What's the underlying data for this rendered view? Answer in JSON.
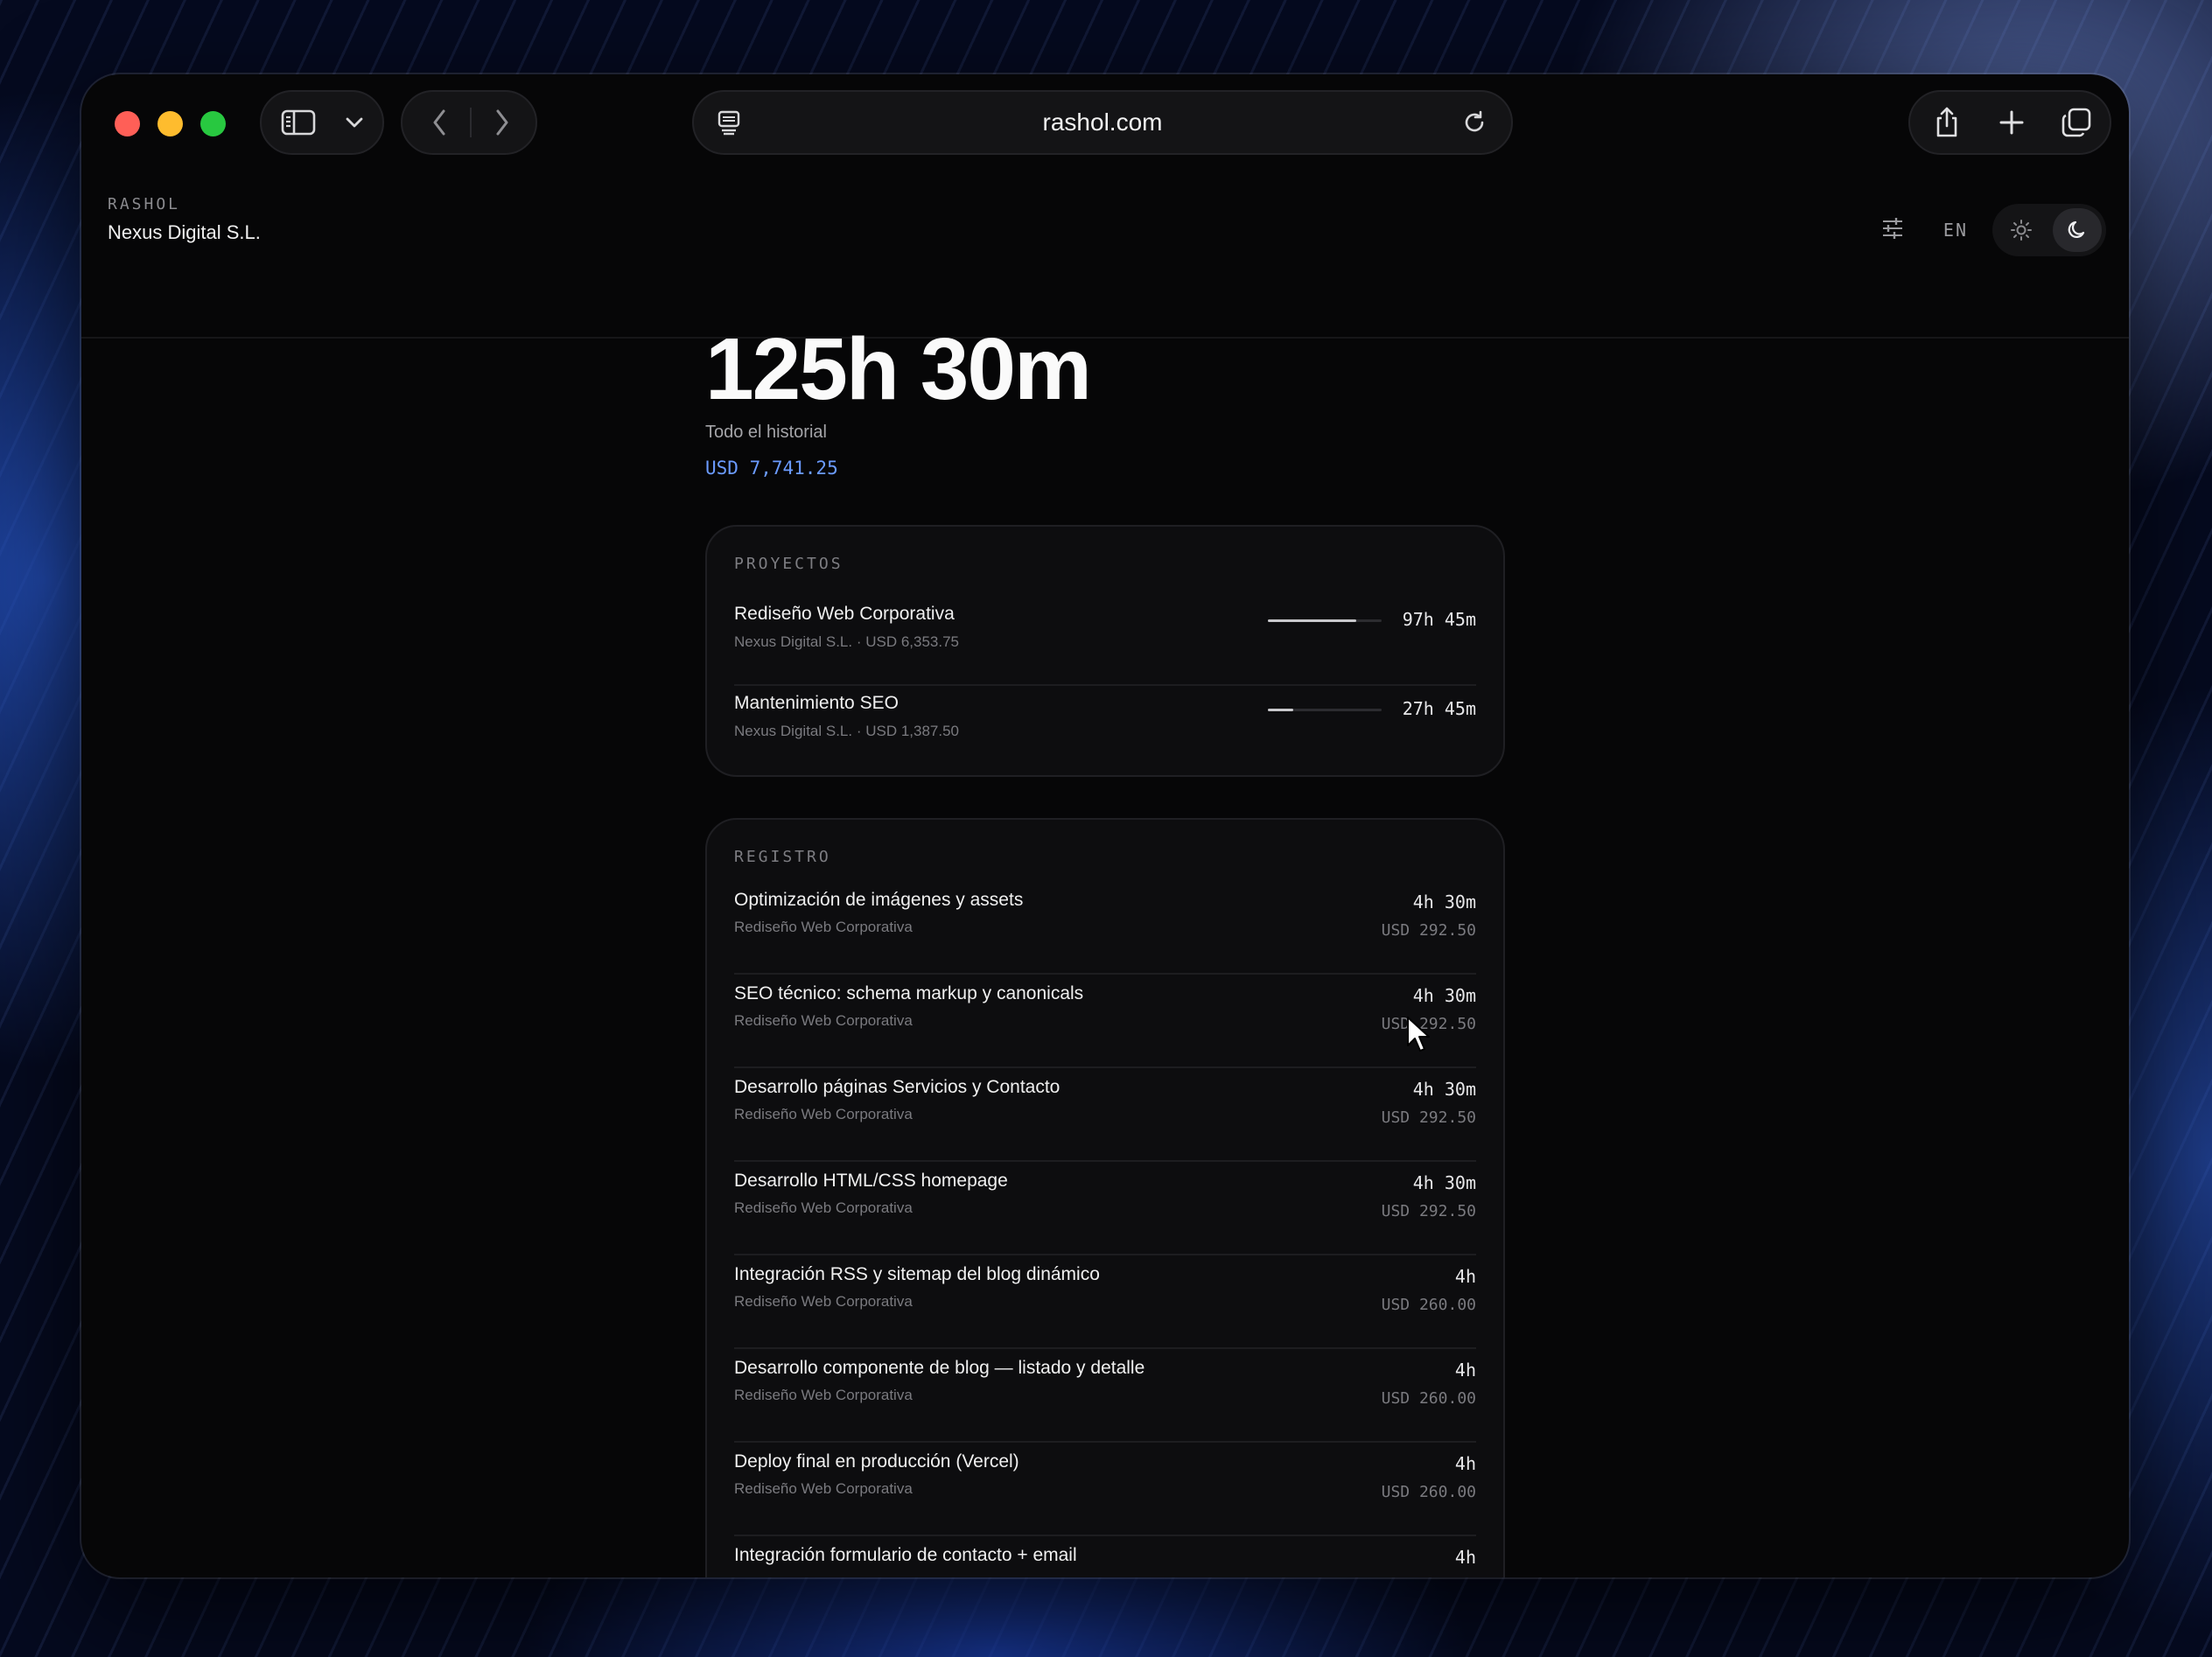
{
  "browser": {
    "url": "rashol.com",
    "icons": [
      "sidebar-icon",
      "chevron-down-icon",
      "back-icon",
      "forward-icon",
      "page-icon",
      "reload-icon",
      "share-icon",
      "plus-icon",
      "tabs-icon"
    ]
  },
  "header": {
    "brand": "RASHOL",
    "client": "Nexus Digital S.L.",
    "language": "EN"
  },
  "summary": {
    "total": "125h 30m",
    "period": "Todo el historial",
    "amount": "USD 7,741.25"
  },
  "projects": {
    "title": "PROYECTOS",
    "items": [
      {
        "name": "Rediseño Web Corporativa",
        "meta": "Nexus Digital S.L. · USD 6,353.75",
        "time": "97h 45m",
        "share": 0.78
      },
      {
        "name": "Mantenimiento SEO",
        "meta": "Nexus Digital S.L. · USD 1,387.50",
        "time": "27h 45m",
        "share": 0.22
      }
    ]
  },
  "log": {
    "title": "REGISTRO",
    "entries": [
      {
        "task": "Optimización de imágenes y assets",
        "project": "Rediseño Web Corporativa",
        "time": "4h 30m",
        "amount": "USD 292.50"
      },
      {
        "task": "SEO técnico: schema markup y canonicals",
        "project": "Rediseño Web Corporativa",
        "time": "4h 30m",
        "amount": "USD 292.50"
      },
      {
        "task": "Desarrollo páginas Servicios y Contacto",
        "project": "Rediseño Web Corporativa",
        "time": "4h 30m",
        "amount": "USD 292.50"
      },
      {
        "task": "Desarrollo HTML/CSS homepage",
        "project": "Rediseño Web Corporativa",
        "time": "4h 30m",
        "amount": "USD 292.50"
      },
      {
        "task": "Integración RSS y sitemap del blog dinámico",
        "project": "Rediseño Web Corporativa",
        "time": "4h",
        "amount": "USD 260.00"
      },
      {
        "task": "Desarrollo componente de blog — listado y detalle",
        "project": "Rediseño Web Corporativa",
        "time": "4h",
        "amount": "USD 260.00"
      },
      {
        "task": "Deploy final en producción (Vercel)",
        "project": "Rediseño Web Corporativa",
        "time": "4h",
        "amount": "USD 260.00"
      },
      {
        "task": "Integración formulario de contacto + email",
        "project": "",
        "time": "4h",
        "amount": ""
      }
    ]
  }
}
